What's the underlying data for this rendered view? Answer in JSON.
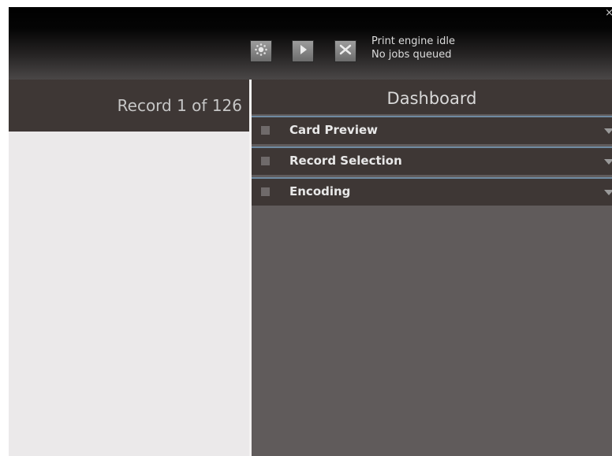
{
  "toolbar": {
    "close_label": "×",
    "status_line1": "Print engine idle",
    "status_line2": "No jobs queued",
    "icons": [
      "settings-icon",
      "play-icon",
      "cancel-icon"
    ]
  },
  "record": {
    "header": "Record 1 of 126"
  },
  "dashboard": {
    "title": "Dashboard",
    "sections": [
      {
        "label": "Card Preview"
      },
      {
        "label": "Record Selection"
      },
      {
        "label": "Encoding"
      }
    ]
  },
  "colors": {
    "panel_dark": "#3e3735",
    "panel_mid": "#605b5b",
    "accent_blue": "#6f8aa1"
  }
}
